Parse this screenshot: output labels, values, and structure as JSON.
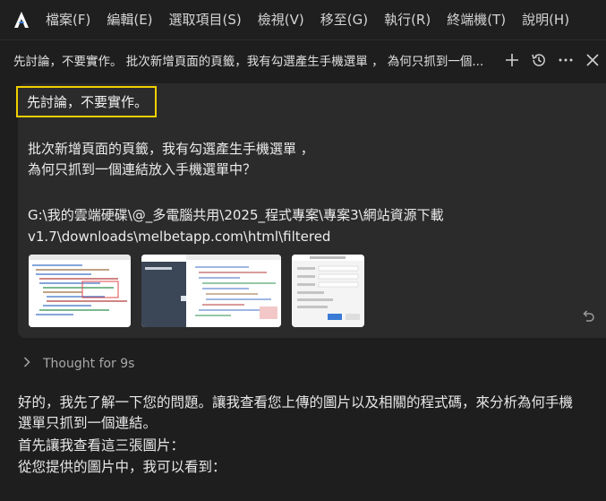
{
  "menubar": {
    "items": [
      "檔案(F)",
      "編輯(E)",
      "選取項目(S)",
      "檢視(V)",
      "移至(G)",
      "執行(R)",
      "終端機(T)",
      "說明(H)"
    ]
  },
  "header": {
    "chat_title": "先討論，不要實作。 批次新增頁面的頁籤，我有勾選產生手機選單 ， 為何只抓到一個..."
  },
  "user_message": {
    "highlight": "先討論，不要實作。",
    "line1": "批次新增頁面的頁籤，我有勾選產生手機選單 ，",
    "line2": "為何只抓到一個連結放入手機選單中？",
    "path1": "G:\\我的雲端硬碟\\@_多電腦共用\\2025_程式專案\\專案3\\網站資源下載",
    "path2": "v1.7\\downloads\\melbetapp.com\\html\\filtered"
  },
  "thought": {
    "label": "Thought for 9s"
  },
  "response": {
    "line1": "好的，我先了解一下您的問題。讓我查看您上傳的圖片以及相關的程式碼，來分析為何手機",
    "line2": "選單只抓到一個連結。",
    "line3": "首先讓我查看這三張圖片：",
    "line4": "從您提供的圖片中，我可以看到："
  },
  "colors": {
    "accent_highlight": "#f0d000",
    "background": "#1e1e1e",
    "bubble": "#2b2b2b"
  },
  "icons": [
    "app-logo-icon",
    "plus-icon",
    "history-icon",
    "more-icon",
    "close-icon",
    "chevron-right-icon",
    "undo-icon"
  ]
}
